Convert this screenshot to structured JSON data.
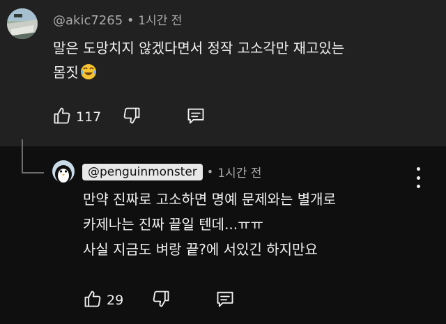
{
  "comment": {
    "handle": "@akic7265",
    "separator": "•",
    "time": "1시간 전",
    "text_line1": "말은 도망치지 않겠다면서 정작 고소각만 재고있는",
    "text_line2": "몸짓",
    "emoji_icon": "face-with-tears-of-joy-icon",
    "likes": "117"
  },
  "reply": {
    "handle": "@penguinmonster",
    "separator": "•",
    "time": "1시간 전",
    "text_line1": "만약 진짜로 고소하면 명예 문제와는 별개로",
    "text_line2": "카제나는 진짜 끝일 텐데...ㅠㅠ",
    "text_line3": "사실 지금도 벼랑 끝?에 서있긴 하지만요",
    "likes": "29"
  },
  "icons": {
    "like": "thumbs-up-icon",
    "dislike": "thumbs-down-icon",
    "reply": "reply-comment-icon",
    "more": "more-vert-icon"
  },
  "colors": {
    "top_background": "#212121",
    "bottom_background": "#0f0f0f",
    "primary_text": "#f1f1f1",
    "secondary_text": "#aaaaaa",
    "handle_chip": "#e8e8e8"
  }
}
